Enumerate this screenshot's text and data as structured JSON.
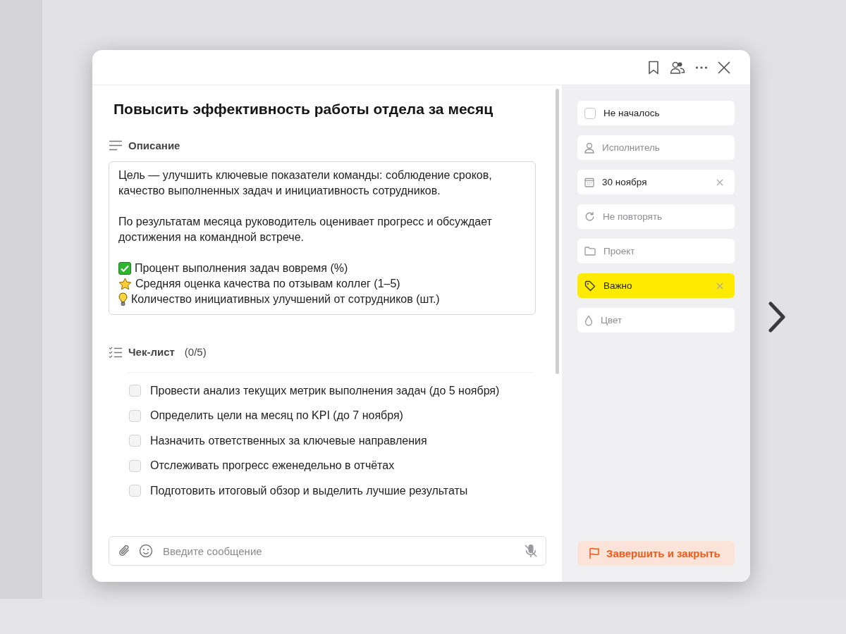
{
  "header": {
    "actions": [
      {
        "kind": "bookmark"
      },
      {
        "kind": "members"
      },
      {
        "kind": "more"
      },
      {
        "kind": "close"
      }
    ]
  },
  "task": {
    "title": "Повысить эффективность работы отдела за месяц",
    "description": {
      "label": "Описание",
      "paragraphs": [
        "Цель — улучшить ключевые показатели команды: соблюдение сроков, качество выполненных задач и инициативность сотрудников.",
        "По результатам месяца руководитель оценивает прогресс и обсуждает достижения на командной встрече."
      ],
      "metrics": [
        {
          "kind": "check",
          "text": "Процент выполнения задач вовремя (%)"
        },
        {
          "kind": "star",
          "text": "Средняя оценка качества по отзывам коллег (1–5)"
        },
        {
          "kind": "bulb",
          "text": "Количество инициативных улучшений от сотрудников (шт.)"
        }
      ]
    },
    "checklist": {
      "label": "Чек-лист",
      "count": "(0/5)",
      "items": [
        {
          "text": "Провести анализ текущих метрик выполнения задач (до 5 ноября)",
          "checked": false
        },
        {
          "text": "Определить цели на месяц по KPI (до 7 ноября)",
          "checked": false
        },
        {
          "text": "Назначить ответственных за ключевые направления",
          "checked": false
        },
        {
          "text": "Отслеживать прогресс еженедельно в отчётах",
          "checked": false
        },
        {
          "text": "Подготовить итоговый обзор и выделить лучшие результаты",
          "checked": false
        }
      ]
    },
    "message": {
      "placeholder": "Введите сообщение"
    }
  },
  "properties": [
    {
      "kind": "status",
      "value": "Не началось",
      "checked": false
    },
    {
      "kind": "assignee",
      "placeholder": "Исполнитель"
    },
    {
      "kind": "date",
      "value": "30 ноября",
      "clearable": true
    },
    {
      "kind": "repeat",
      "placeholder": "Не повторять"
    },
    {
      "kind": "project",
      "placeholder": "Проект"
    },
    {
      "kind": "tag",
      "value": "Важно",
      "color": "#ffea00",
      "clearable": true
    },
    {
      "kind": "color",
      "placeholder": "Цвет"
    }
  ],
  "complete_button": {
    "label": "Завершить и закрыть"
  }
}
